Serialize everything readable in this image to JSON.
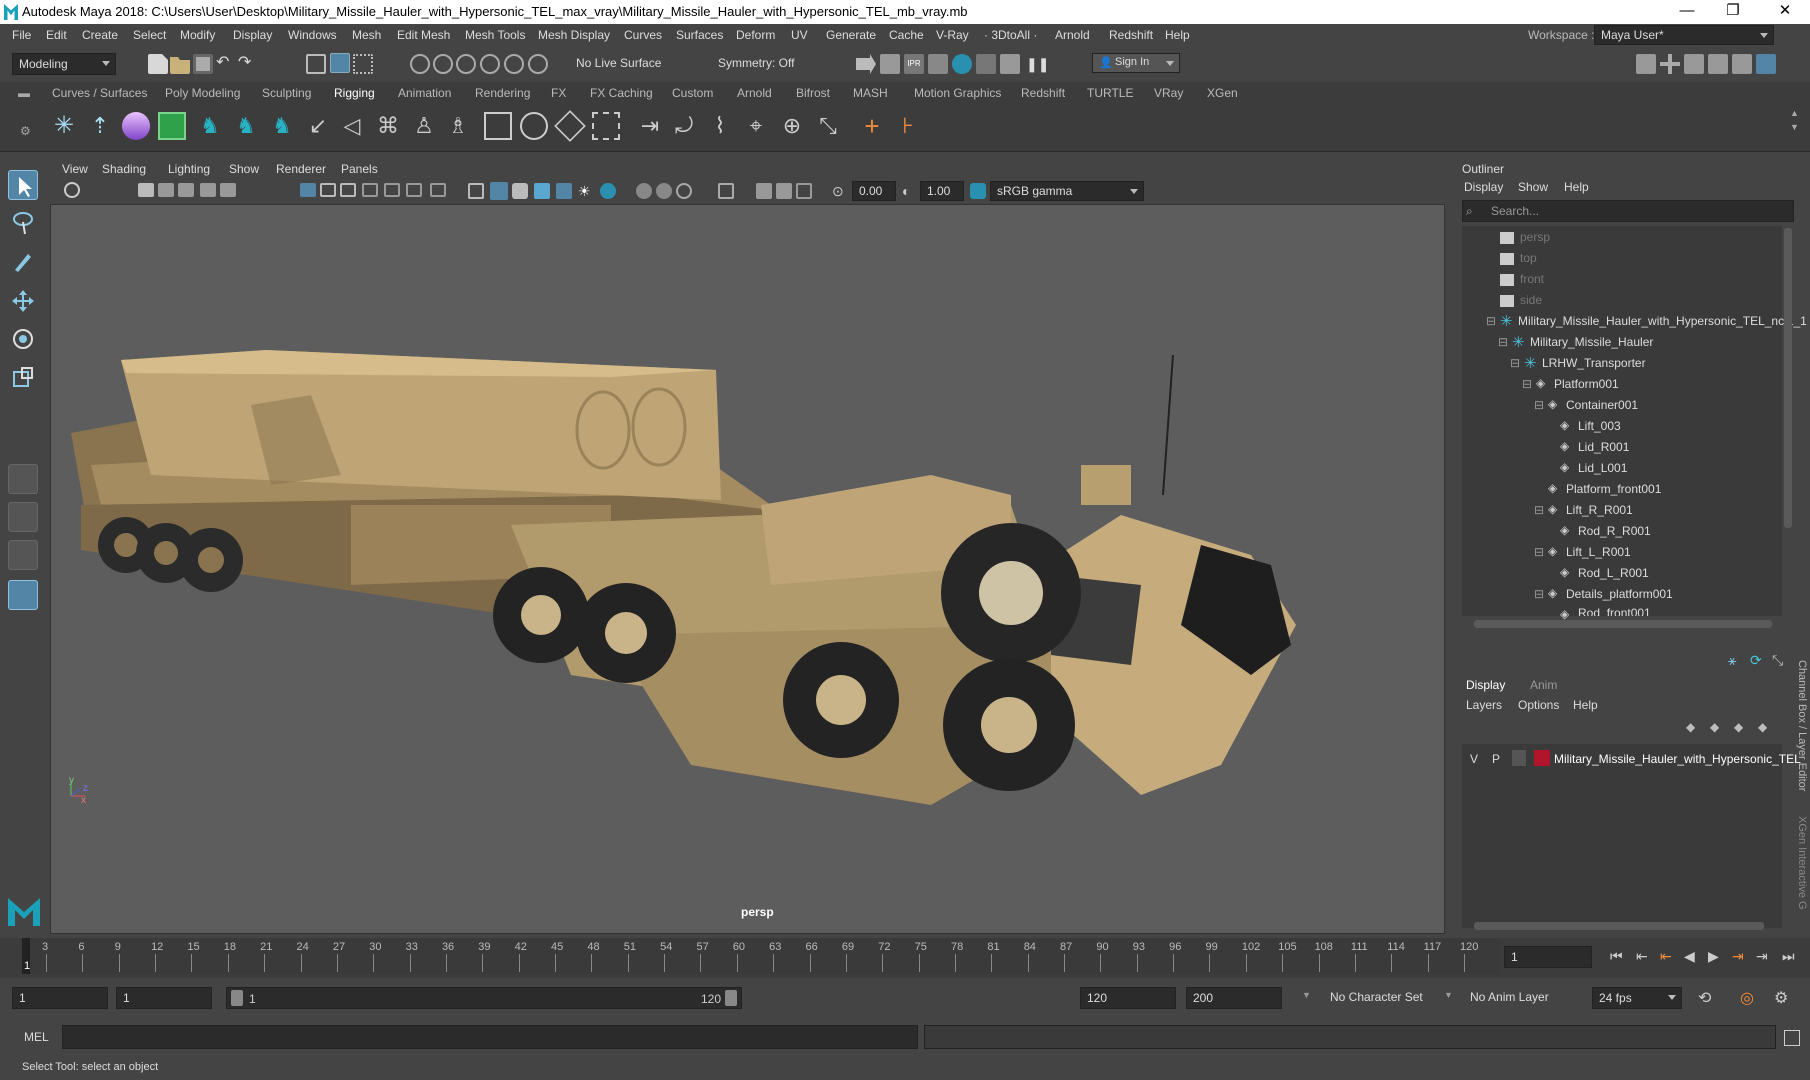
{
  "window": {
    "title": "Autodesk Maya 2018: C:\\Users\\User\\Desktop\\Military_Missile_Hauler_with_Hypersonic_TEL_max_vray\\Military_Missile_Hauler_with_Hypersonic_TEL_mb_vray.mb",
    "minimize": "—",
    "maximize": "❐",
    "close": "✕"
  },
  "menubar": {
    "items": [
      "File",
      "Edit",
      "Create",
      "Select",
      "Modify",
      "Display",
      "Windows",
      "Mesh",
      "Edit Mesh",
      "Mesh Tools",
      "Mesh Display",
      "Curves",
      "Surfaces",
      "Deform",
      "UV",
      "Generate",
      "Cache",
      "V-Ray",
      "· 3DtoAll ·",
      "Arnold",
      "Redshift",
      "Help"
    ],
    "workspace_label": "Workspace :",
    "workspace_value": "Maya User*"
  },
  "statusline": {
    "mode": "Modeling",
    "live_surface": "No Live Surface",
    "symmetry": "Symmetry: Off",
    "sign_in": "Sign In"
  },
  "shelf_tabs": [
    "Curves / Surfaces",
    "Poly Modeling",
    "Sculpting",
    "Rigging",
    "Animation",
    "Rendering",
    "FX",
    "FX Caching",
    "Custom",
    "Arnold",
    "Bifrost",
    "MASH",
    "Motion Graphics",
    "Redshift",
    "TURTLE",
    "VRay",
    "XGen"
  ],
  "active_shelf_tab": "Rigging",
  "viewport": {
    "menu": [
      "View",
      "Shading",
      "Lighting",
      "Show",
      "Renderer",
      "Panels"
    ],
    "exposure": "0.00",
    "gamma": "1.00",
    "color_space": "sRGB gamma",
    "camera_label": "persp",
    "axis_y": "y",
    "axis_x": "x",
    "axis_z": "z"
  },
  "outliner": {
    "title": "Outliner",
    "menu": [
      "Display",
      "Show",
      "Help"
    ],
    "search_placeholder": "Search...",
    "items": [
      {
        "label": "persp",
        "icon": "camera-icon",
        "dim": true
      },
      {
        "label": "top",
        "icon": "camera-icon",
        "dim": true
      },
      {
        "label": "front",
        "icon": "camera-icon",
        "dim": true
      },
      {
        "label": "side",
        "icon": "camera-icon",
        "dim": true
      },
      {
        "label": "Military_Missile_Hauler_with_Hypersonic_TEL_ncl1_1",
        "icon": "joint-icon"
      },
      {
        "label": "Military_Missile_Hauler",
        "icon": "joint-icon"
      },
      {
        "label": "LRHW_Transporter",
        "icon": "joint-icon"
      },
      {
        "label": "Platform001",
        "icon": "mesh-icon"
      },
      {
        "label": "Container001",
        "icon": "mesh-icon"
      },
      {
        "label": "Lift_003",
        "icon": "mesh-icon"
      },
      {
        "label": "Lid_R001",
        "icon": "mesh-icon"
      },
      {
        "label": "Lid_L001",
        "icon": "mesh-icon"
      },
      {
        "label": "Platform_front001",
        "icon": "mesh-icon"
      },
      {
        "label": "Lift_R_R001",
        "icon": "mesh-icon"
      },
      {
        "label": "Rod_R_R001",
        "icon": "mesh-icon"
      },
      {
        "label": "Lift_L_R001",
        "icon": "mesh-icon"
      },
      {
        "label": "Rod_L_R001",
        "icon": "mesh-icon"
      },
      {
        "label": "Details_platform001",
        "icon": "mesh-icon"
      },
      {
        "label": "Rod_front001",
        "icon": "mesh-icon"
      }
    ]
  },
  "layer_editor": {
    "tabs": [
      "Display",
      "Anim"
    ],
    "menu": [
      "Layers",
      "Options",
      "Help"
    ],
    "layer": {
      "v": "V",
      "p": "P",
      "name": "Military_Missile_Hauler_with_Hypersonic_TEL",
      "color": "#b0152b"
    },
    "side_tabs": [
      "Channel Box / Layer Editor",
      "XGen Interactive G"
    ]
  },
  "timeline": {
    "ticks": [
      "3",
      "6",
      "9",
      "12",
      "15",
      "18",
      "21",
      "24",
      "27",
      "30",
      "33",
      "36",
      "39",
      "42",
      "45",
      "48",
      "51",
      "54",
      "57",
      "60",
      "63",
      "66",
      "69",
      "72",
      "75",
      "78",
      "81",
      "84",
      "87",
      "90",
      "93",
      "96",
      "99",
      "102",
      "105",
      "108",
      "111",
      "114",
      "117",
      "120"
    ],
    "start_marker": "1",
    "current_frame": "1"
  },
  "range": {
    "start": "1",
    "playback_start": "1",
    "slider_start": "1",
    "slider_end": "120",
    "playback_end": "120",
    "end": "200",
    "character_set": "No Character Set",
    "anim_layer": "No Anim Layer",
    "fps": "24 fps"
  },
  "command": {
    "label": "MEL"
  },
  "help_line": "Select Tool: select an object",
  "colors": {
    "accent": "#5285a6",
    "tan": "#c4a877",
    "brand": "#1aa0b8"
  }
}
